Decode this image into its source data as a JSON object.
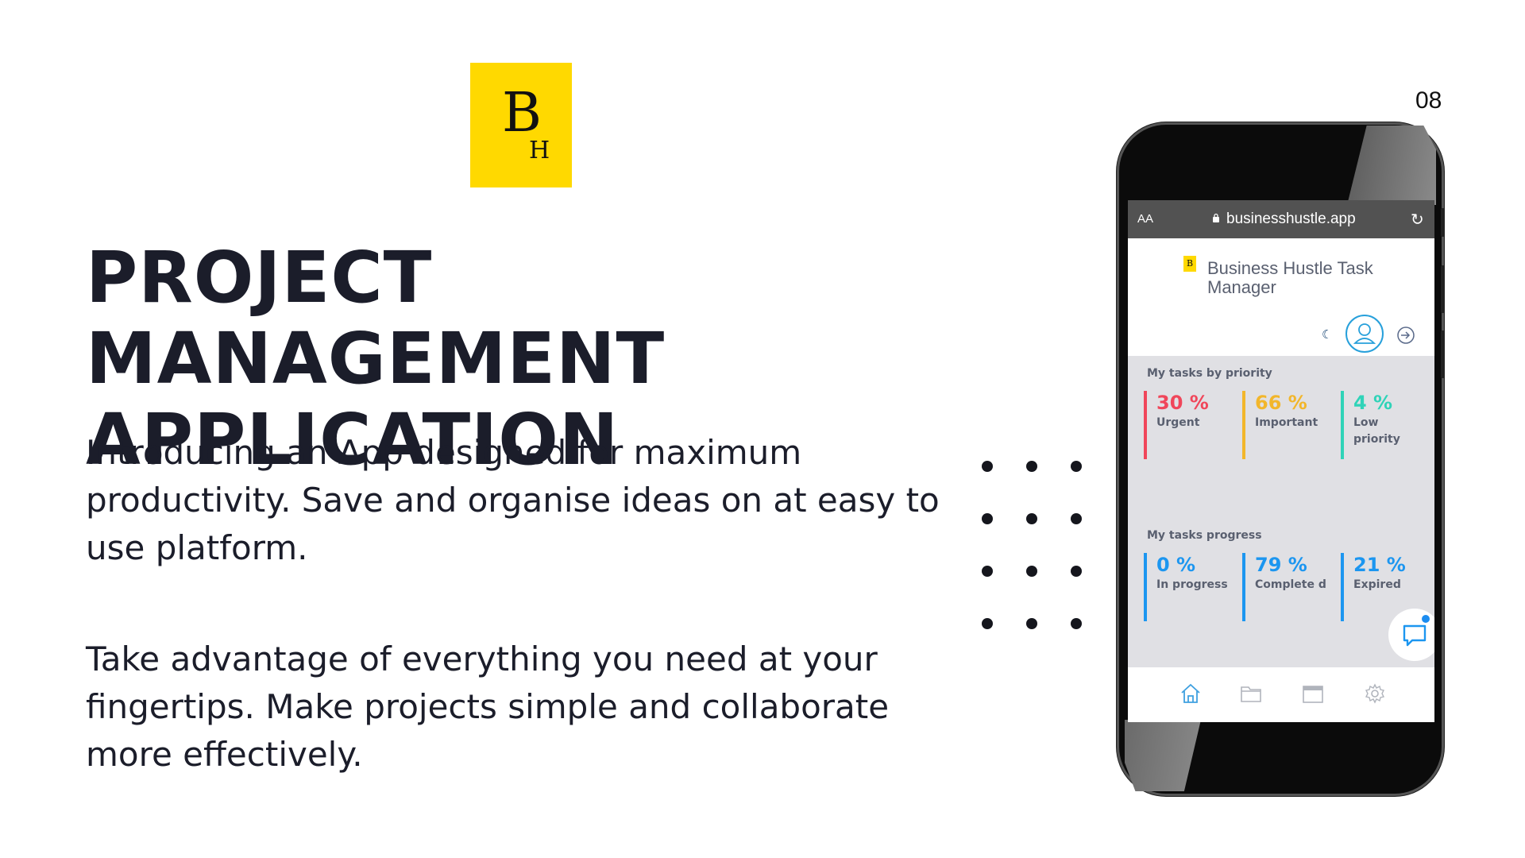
{
  "logo": {
    "letter_b": "B",
    "letter_h": "H",
    "background": "#ffd900"
  },
  "page_number": "08",
  "title": {
    "line1": "PROJECT MANAGEMENT",
    "line2": "APPLICATION"
  },
  "paragraphs": {
    "intro": "Introducing an App designed for maximum productivity. Save and organise ideas on at easy to use platform.",
    "second": "Take advantage of everything you need at your fingertips. Make projects simple and collaborate more effectively."
  },
  "phone": {
    "browser": {
      "text_size_button": "AA",
      "url": "businesshustle.app",
      "reload_icon": "reload-icon"
    },
    "app": {
      "logo_letter": "B",
      "title": "Business Hustle Task Manager",
      "icons": [
        "moon-icon",
        "user-icon",
        "logout-icon"
      ],
      "priority": {
        "heading": "My tasks by priority",
        "items": [
          {
            "pct": "30 %",
            "label": "Urgent",
            "color": "#f0465a"
          },
          {
            "pct": "66 %",
            "label": "Important",
            "color": "#f2b62b"
          },
          {
            "pct": "4 %",
            "label": "Low priority",
            "color": "#2fd3b8"
          }
        ]
      },
      "progress": {
        "heading": "My tasks progress",
        "items": [
          {
            "pct": "0 %",
            "label": "In progress",
            "color": "#1c96f0"
          },
          {
            "pct": "79 %",
            "label": "Complete d",
            "color": "#1c96f0"
          },
          {
            "pct": "21 %",
            "label": "Expired",
            "color": "#1c96f0"
          }
        ]
      },
      "nav": [
        "home-icon",
        "folder-icon",
        "calendar-icon",
        "settings-icon"
      ],
      "chat_icon": "chat-icon"
    }
  }
}
